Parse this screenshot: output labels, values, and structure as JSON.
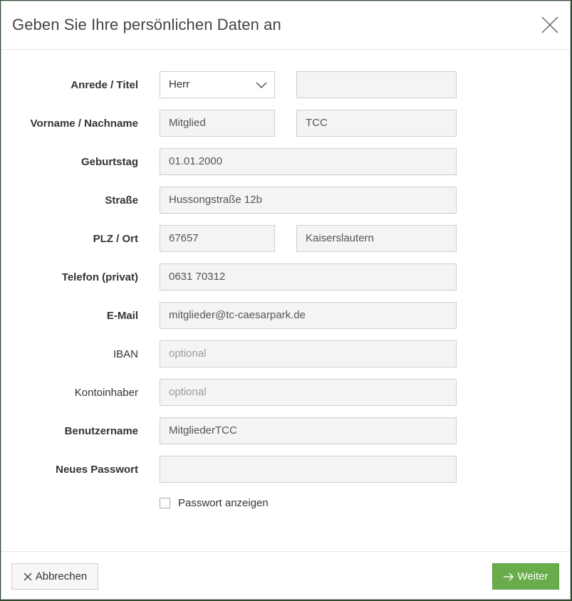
{
  "title": "Geben Sie Ihre persönlichen Daten an",
  "form": {
    "anrede_label": "Anrede / Titel",
    "anrede_value": "Herr",
    "titel_value": "",
    "name_label": "Vorname / Nachname",
    "vorname_value": "Mitglied",
    "nachname_value": "TCC",
    "geburtstag_label": "Geburtstag",
    "geburtstag_value": "01.01.2000",
    "strasse_label": "Straße",
    "strasse_value": "Hussongstraße 12b",
    "plzort_label": "PLZ / Ort",
    "plz_value": "67657",
    "ort_value": "Kaiserslautern",
    "telefon_label": "Telefon (privat)",
    "telefon_value": "0631 70312",
    "email_label": "E-Mail",
    "email_value": "mitglieder@tc-caesarpark.de",
    "iban_label": "IBAN",
    "iban_placeholder": "optional",
    "kontoinhaber_label": "Kontoinhaber",
    "kontoinhaber_placeholder": "optional",
    "benutzername_label": "Benutzername",
    "benutzername_value": "MitgliederTCC",
    "passwort_label": "Neues Passwort",
    "passwort_value": "",
    "show_password_label": "Passwort anzeigen"
  },
  "footer": {
    "cancel_label": "Abbrechen",
    "next_label": "Weiter"
  },
  "colors": {
    "primary_button": "#6aab4c",
    "input_background": "#f4f4f4"
  }
}
